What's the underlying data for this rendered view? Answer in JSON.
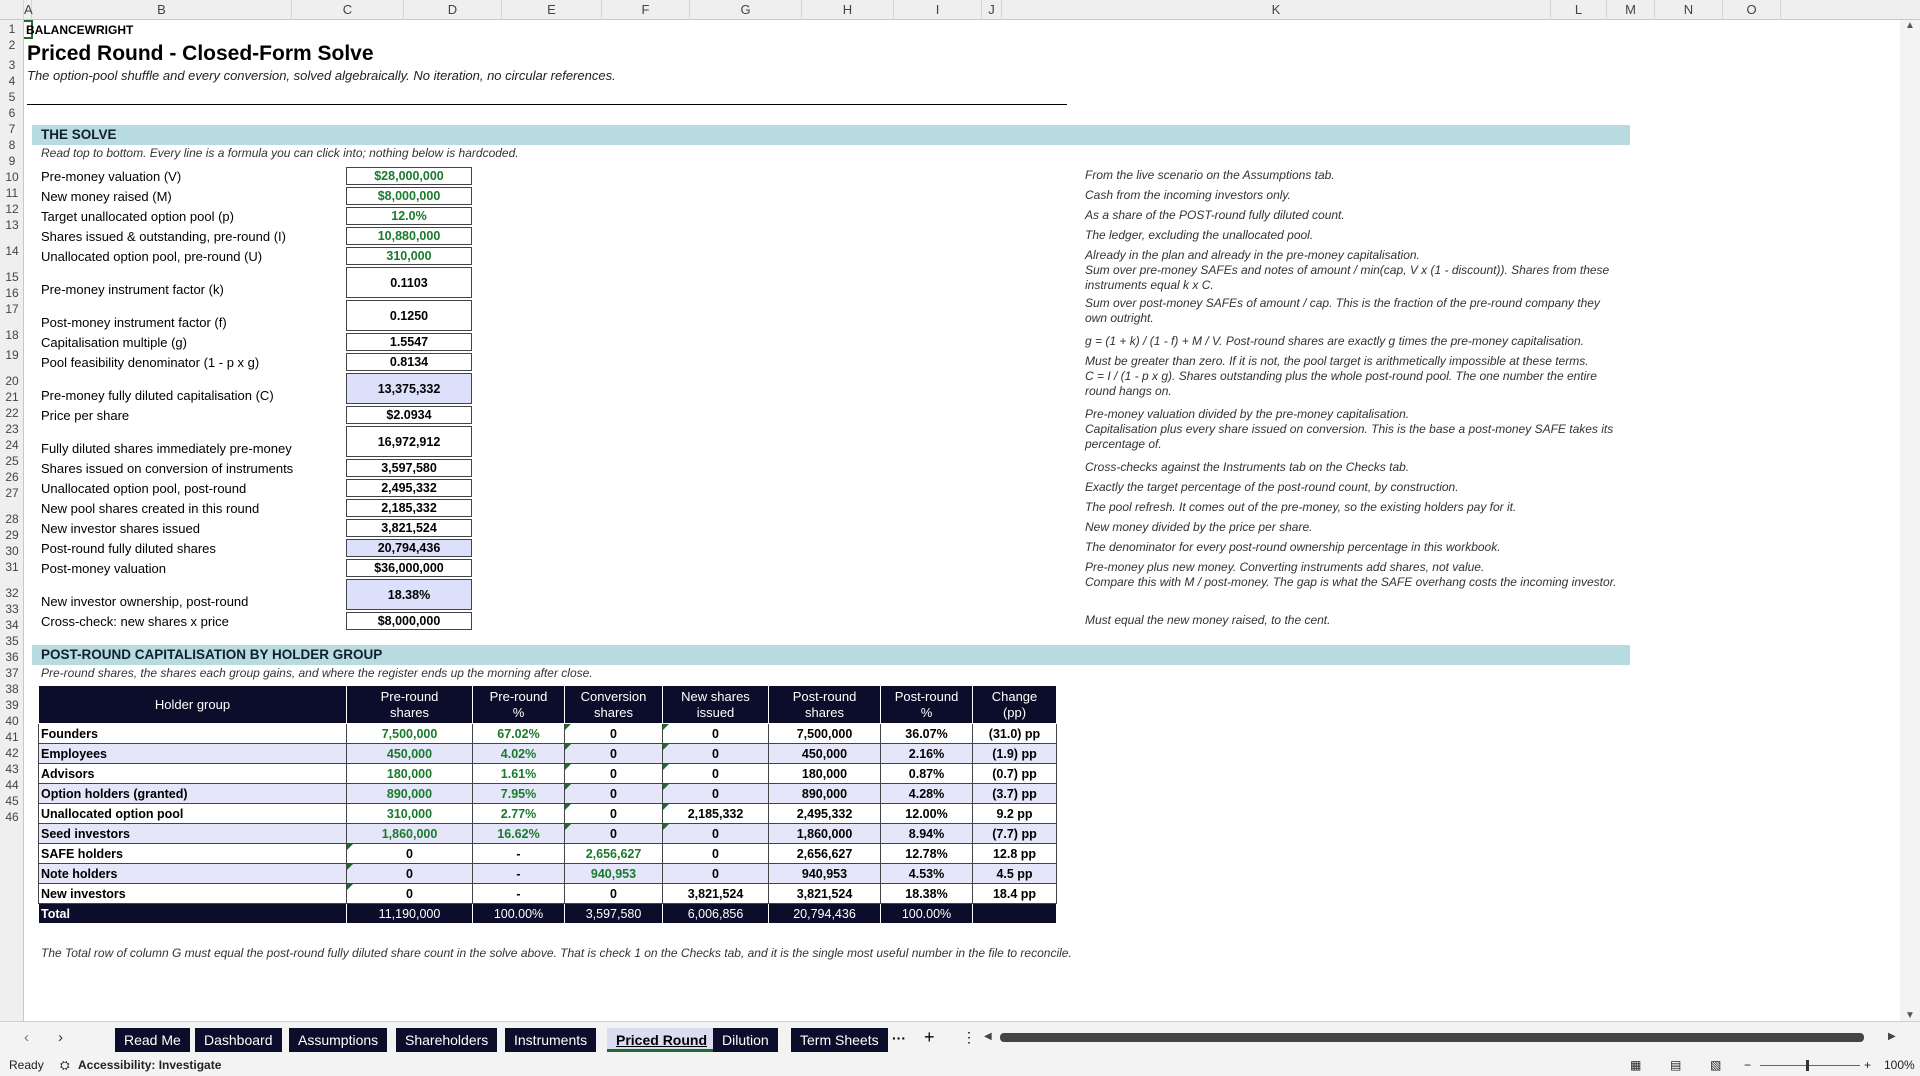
{
  "columns": [
    "A",
    "B",
    "C",
    "D",
    "E",
    "F",
    "G",
    "H",
    "I",
    "J",
    "K",
    "L",
    "M",
    "N",
    "O"
  ],
  "rows": [
    "1",
    "2",
    "3",
    "4",
    "5",
    "6",
    "7",
    "8",
    "9",
    "10",
    "11",
    "12",
    "13",
    "14",
    "15",
    "16",
    "17",
    "18",
    "19",
    "20",
    "21",
    "22",
    "23",
    "24",
    "25",
    "26",
    "27",
    "28",
    "29",
    "30",
    "31",
    "32",
    "33",
    "34",
    "35",
    "36",
    "37",
    "38",
    "39",
    "40",
    "41",
    "42",
    "43",
    "44",
    "45",
    "46"
  ],
  "header": {
    "brand": "BALANCEWRIGHT",
    "title": "Priced Round - Closed-Form Solve",
    "subtitle": "The option-pool shuffle and every conversion, solved algebraically. No iteration, no circular references."
  },
  "solve": {
    "band": "THE SOLVE",
    "note": "Read top to bottom. Every line is a formula you can click into; nothing below is hardcoded.",
    "lines": [
      {
        "label": "Pre-money valuation  (V)",
        "value": "$28,000,000",
        "note": "From the live scenario on the Assumptions tab."
      },
      {
        "label": "New money raised  (M)",
        "value": "$8,000,000",
        "note": "Cash from the incoming investors only."
      },
      {
        "label": "Target unallocated option pool  (p)",
        "value": "12.0%",
        "note": "As a share of the POST-round fully diluted count."
      },
      {
        "label": "Shares issued & outstanding, pre-round  (I)",
        "value": "10,880,000",
        "note": "The ledger, excluding the unallocated pool."
      },
      {
        "label": "Unallocated option pool, pre-round  (U)",
        "value": "310,000",
        "note": "Already in the plan and already in the pre-money capitalisation."
      },
      {
        "label": "Pre-money instrument factor  (k)",
        "value": "0.1103",
        "note": "Sum over pre-money SAFEs and notes of amount / min(cap, V x (1 - discount)). Shares from these instruments equal k x C."
      },
      {
        "label": "Post-money instrument factor  (f)",
        "value": "0.1250",
        "note": "Sum over post-money SAFEs of amount / cap. This is the fraction of the pre-round company they own outright."
      },
      {
        "label": "Capitalisation multiple  (g)",
        "value": "1.5547",
        "note": "g = (1 + k) / (1 - f) + M / V.  Post-round shares are exactly g times the pre-money capitalisation."
      },
      {
        "label": "Pool feasibility denominator  (1 - p x g)",
        "value": "0.8134",
        "note": "Must be greater than zero. If it is not, the pool target is arithmetically impossible at these terms."
      },
      {
        "label": "Pre-money fully diluted capitalisation  (C)",
        "value": "13,375,332",
        "note": "C = I / (1 - p x g). Shares outstanding plus the whole post-round pool. The one number the entire round hangs on."
      },
      {
        "label": "Price per share",
        "value": "$2.0934",
        "note": "Pre-money valuation divided by the pre-money capitalisation."
      },
      {
        "label": "Fully diluted shares immediately pre-money",
        "value": "16,972,912",
        "note": "Capitalisation plus every share issued on conversion. This is the base a post-money SAFE takes its percentage of."
      },
      {
        "label": "Shares issued on conversion of instruments",
        "value": "3,597,580",
        "note": "Cross-checks against the Instruments tab on the Checks tab."
      },
      {
        "label": "Unallocated option pool, post-round",
        "value": "2,495,332",
        "note": "Exactly the target percentage of the post-round count, by construction."
      },
      {
        "label": "New pool shares created in this round",
        "value": "2,185,332",
        "note": "The pool refresh. It comes out of the pre-money, so the existing holders pay for it."
      },
      {
        "label": "New investor shares issued",
        "value": "3,821,524",
        "note": "New money divided by the price per share."
      },
      {
        "label": "Post-round fully diluted shares",
        "value": "20,794,436",
        "note": "The denominator for every post-round ownership percentage in this workbook."
      },
      {
        "label": "Post-money valuation",
        "value": "$36,000,000",
        "note": "Pre-money plus new money. Converting instruments add shares, not value."
      },
      {
        "label": "New investor ownership, post-round",
        "value": "18.38%",
        "note": "Compare this with M / post-money. The gap is what the SAFE overhang costs the incoming investor."
      },
      {
        "label": "Cross-check: new shares x price",
        "value": "$8,000,000",
        "note": "Must equal the new money raised, to the cent."
      }
    ]
  },
  "cap": {
    "band": "POST-ROUND CAPITALISATION BY HOLDER GROUP",
    "note": "Pre-round shares, the shares each group gains, and where the register ends up the morning after close.",
    "headers": [
      "Holder group",
      "Pre-round\nshares",
      "Pre-round\n%",
      "Conversion\nshares",
      "New shares\nissued",
      "Post-round\nshares",
      "Post-round\n%",
      "Change\n(pp)"
    ],
    "rows": [
      [
        "Founders",
        "7,500,000",
        "67.02%",
        "0",
        "0",
        "7,500,000",
        "36.07%",
        "(31.0) pp"
      ],
      [
        "Employees",
        "450,000",
        "4.02%",
        "0",
        "0",
        "450,000",
        "2.16%",
        "(1.9) pp"
      ],
      [
        "Advisors",
        "180,000",
        "1.61%",
        "0",
        "0",
        "180,000",
        "0.87%",
        "(0.7) pp"
      ],
      [
        "Option holders (granted)",
        "890,000",
        "7.95%",
        "0",
        "0",
        "890,000",
        "4.28%",
        "(3.7) pp"
      ],
      [
        "Unallocated option pool",
        "310,000",
        "2.77%",
        "0",
        "2,185,332",
        "2,495,332",
        "12.00%",
        "9.2 pp"
      ],
      [
        "Seed investors",
        "1,860,000",
        "16.62%",
        "0",
        "0",
        "1,860,000",
        "8.94%",
        "(7.7) pp"
      ],
      [
        "SAFE holders",
        "0",
        "-",
        "2,656,627",
        "0",
        "2,656,627",
        "12.78%",
        "12.8 pp"
      ],
      [
        "Note holders",
        "0",
        "-",
        "940,953",
        "0",
        "940,953",
        "4.53%",
        "4.5 pp"
      ],
      [
        "New investors",
        "0",
        "-",
        "0",
        "3,821,524",
        "3,821,524",
        "18.38%",
        "18.4 pp"
      ]
    ],
    "total": [
      "Total",
      "11,190,000",
      "100.00%",
      "3,597,580",
      "6,006,856",
      "20,794,436",
      "100.00%",
      ""
    ],
    "footnote": "The Total row of column G must equal the post-round fully diluted share count in the solve above. That is check 1 on the Checks tab, and it is the single most useful number in the file to reconcile."
  },
  "tabs": [
    "Read Me",
    "Dashboard",
    "Assumptions",
    "Shareholders",
    "Instruments",
    "Priced Round",
    "Dilution",
    "Term Sheets"
  ],
  "active_tab": "Priced Round",
  "status": {
    "ready": "Ready",
    "accessibility": "Accessibility: Investigate",
    "zoom": "100%"
  }
}
